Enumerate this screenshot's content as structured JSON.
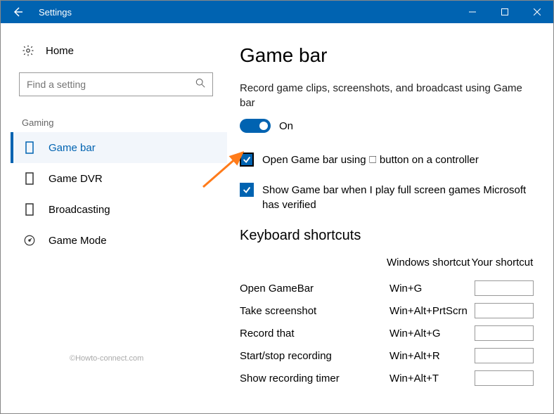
{
  "titlebar": {
    "title": "Settings"
  },
  "sidebar": {
    "home_label": "Home",
    "search_placeholder": "Find a setting",
    "section": "Gaming",
    "items": [
      {
        "label": "Game bar"
      },
      {
        "label": "Game DVR"
      },
      {
        "label": "Broadcasting"
      },
      {
        "label": "Game Mode"
      }
    ]
  },
  "main": {
    "heading": "Game bar",
    "desc": "Record game clips, screenshots, and broadcast using Game bar",
    "toggle_label": "On",
    "check1": "Open Game bar using 🗆 button on a controller",
    "check2": "Show Game bar when I play full screen games Microsoft has verified",
    "shortcuts_heading": "Keyboard shortcuts",
    "col_win": "Windows shortcut",
    "col_your": "Your shortcut",
    "rows": [
      {
        "label": "Open GameBar",
        "win": "Win+G"
      },
      {
        "label": "Take screenshot",
        "win": "Win+Alt+PrtScrn"
      },
      {
        "label": "Record that",
        "win": "Win+Alt+G"
      },
      {
        "label": "Start/stop recording",
        "win": "Win+Alt+R"
      },
      {
        "label": "Show recording timer",
        "win": "Win+Alt+T"
      }
    ]
  },
  "watermark": "©Howto-connect.com"
}
